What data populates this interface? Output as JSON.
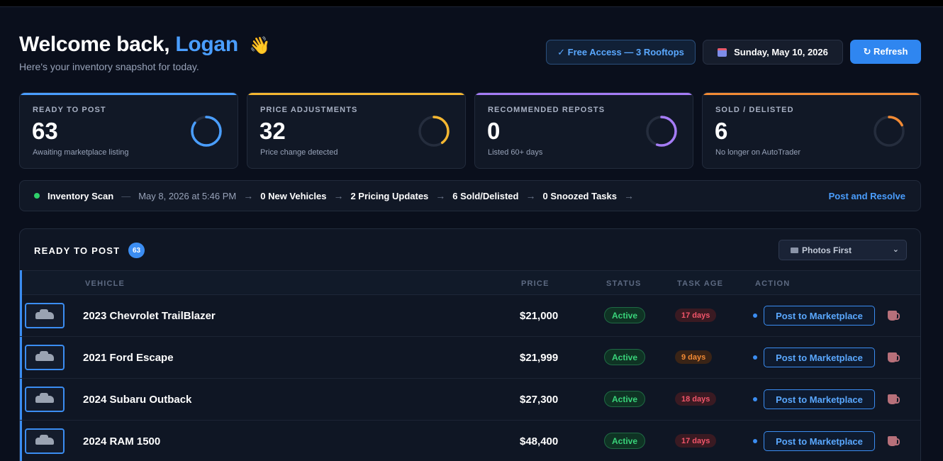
{
  "header": {
    "greeting": "Welcome back,",
    "user_name": "Logan",
    "wave_emoji": "👋",
    "subtitle": "Here's your inventory snapshot for today.",
    "access_label": "✓ Free Access — 3 Rooftops",
    "date_label": "Sunday, May 10, 2026",
    "refresh_label": "↻ Refresh",
    "calendar_icon": "calendar-icon"
  },
  "stats": [
    {
      "label": "READY TO POST",
      "value": "63",
      "desc": "Awaiting marketplace listing",
      "color": "#4a9eff",
      "ring_fraction": 0.85
    },
    {
      "label": "PRICE ADJUSTMENTS",
      "value": "32",
      "desc": "Price change detected",
      "color": "#f5b731",
      "ring_fraction": 0.4
    },
    {
      "label": "RECOMMENDED REPOSTS",
      "value": "0",
      "desc": "Listed 60+ days",
      "color": "#a57cf5",
      "ring_fraction": 0.55
    },
    {
      "label": "SOLD / DELISTED",
      "value": "6",
      "desc": "No longer on AutoTrader",
      "color": "#f28a34",
      "ring_fraction": 0.18
    }
  ],
  "scan": {
    "title": "Inventory Scan",
    "separator": "—",
    "timestamp": "May 8, 2026 at 5:46 PM",
    "arrow": "→",
    "new_vehicles": "0 New Vehicles",
    "pricing_updates": "2 Pricing Updates",
    "sold_delisted": "6 Sold/Delisted",
    "snoozed": "0 Snoozed Tasks",
    "resolve_label": "Post and Resolve"
  },
  "panel": {
    "title": "READY TO POST",
    "count": "63",
    "sort_selected": "Photos First",
    "columns": {
      "vehicle": "VEHICLE",
      "price": "PRICE",
      "status": "STATUS",
      "task_age": "TASK AGE",
      "action": "ACTION"
    },
    "rows": [
      {
        "vehicle": "2023 Chevrolet TrailBlazer",
        "price": "$21,000",
        "status": "Active",
        "age": "17 days",
        "age_color": "red",
        "action": "Post to Marketplace"
      },
      {
        "vehicle": "2021 Ford Escape",
        "price": "$21,999",
        "status": "Active",
        "age": "9 days",
        "age_color": "orange",
        "action": "Post to Marketplace"
      },
      {
        "vehicle": "2024 Subaru Outback",
        "price": "$27,300",
        "status": "Active",
        "age": "18 days",
        "age_color": "red",
        "action": "Post to Marketplace"
      },
      {
        "vehicle": "2024 RAM 1500",
        "price": "$48,400",
        "status": "Active",
        "age": "17 days",
        "age_color": "red",
        "action": "Post to Marketplace"
      }
    ]
  }
}
